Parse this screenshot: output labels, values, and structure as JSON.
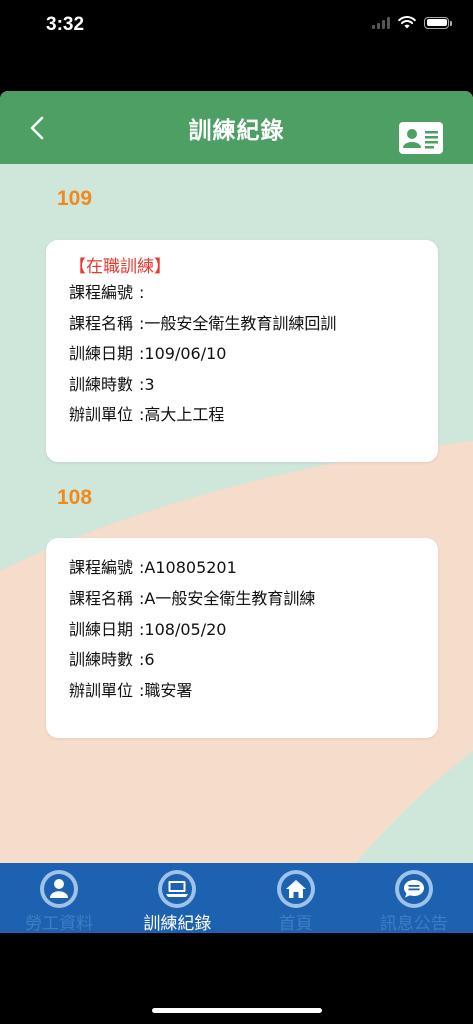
{
  "status_bar": {
    "time": "3:32"
  },
  "header": {
    "title": "訓練紀錄"
  },
  "records": [
    {
      "year": "109",
      "category": "【在職訓練】",
      "fields": [
        {
          "label": "課程編號",
          "value": ""
        },
        {
          "label": "課程名稱",
          "value": "一般安全衛生教育訓練回訓"
        },
        {
          "label": "訓練日期",
          "value": "109/06/10"
        },
        {
          "label": "訓練時數",
          "value": "3"
        },
        {
          "label": "辦訓單位",
          "value": "高大上工程"
        }
      ]
    },
    {
      "year": "108",
      "category": "",
      "fields": [
        {
          "label": "課程編號",
          "value": "A10805201"
        },
        {
          "label": "課程名稱",
          "value": "A一般安全衛生教育訓練"
        },
        {
          "label": "訓練日期",
          "value": "108/05/20"
        },
        {
          "label": "訓練時數",
          "value": "6"
        },
        {
          "label": "辦訓單位",
          "value": "職安署"
        }
      ]
    }
  ],
  "tabs": [
    {
      "label": "勞工資料",
      "icon": "person-icon",
      "active": false
    },
    {
      "label": "訓練紀錄",
      "icon": "laptop-icon",
      "active": true
    },
    {
      "label": "首頁",
      "icon": "home-icon",
      "active": false
    },
    {
      "label": "訊息公告",
      "icon": "chat-icon",
      "active": false
    }
  ],
  "colors": {
    "header_green": "#4e9f63",
    "year_orange": "#f08a1e",
    "category_red": "#e8382e",
    "tab_blue": "#1d62b0",
    "bg_mint": "#cfe6db",
    "bg_peach": "#f6dccb"
  }
}
